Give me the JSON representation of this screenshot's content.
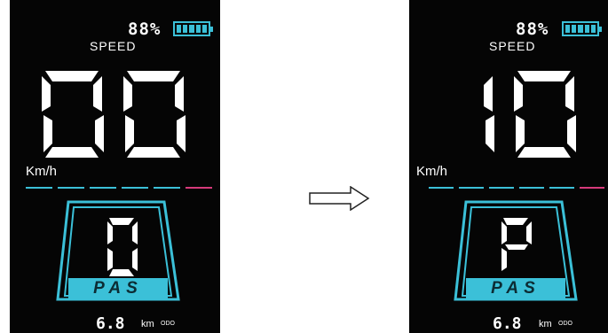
{
  "battery": {
    "percent": "88%",
    "level": 1.0
  },
  "labels": {
    "speed": "SPEED",
    "unit": "Km/h",
    "pas": "PAS",
    "distance_unit": "km",
    "distance_tag": "ODO"
  },
  "before": {
    "speed_digits": "00",
    "odometer": "6.8",
    "pas_level": "0"
  },
  "after": {
    "speed_digits": "10",
    "odometer": "6.8",
    "pas_level": "P"
  },
  "colors": {
    "background": "#050505",
    "accent": "#3bc0d8",
    "text": "#ffffff",
    "dash_highlight": "#d63a7a"
  },
  "icons": {
    "transition": "right-arrow-icon",
    "battery": "battery-icon"
  }
}
